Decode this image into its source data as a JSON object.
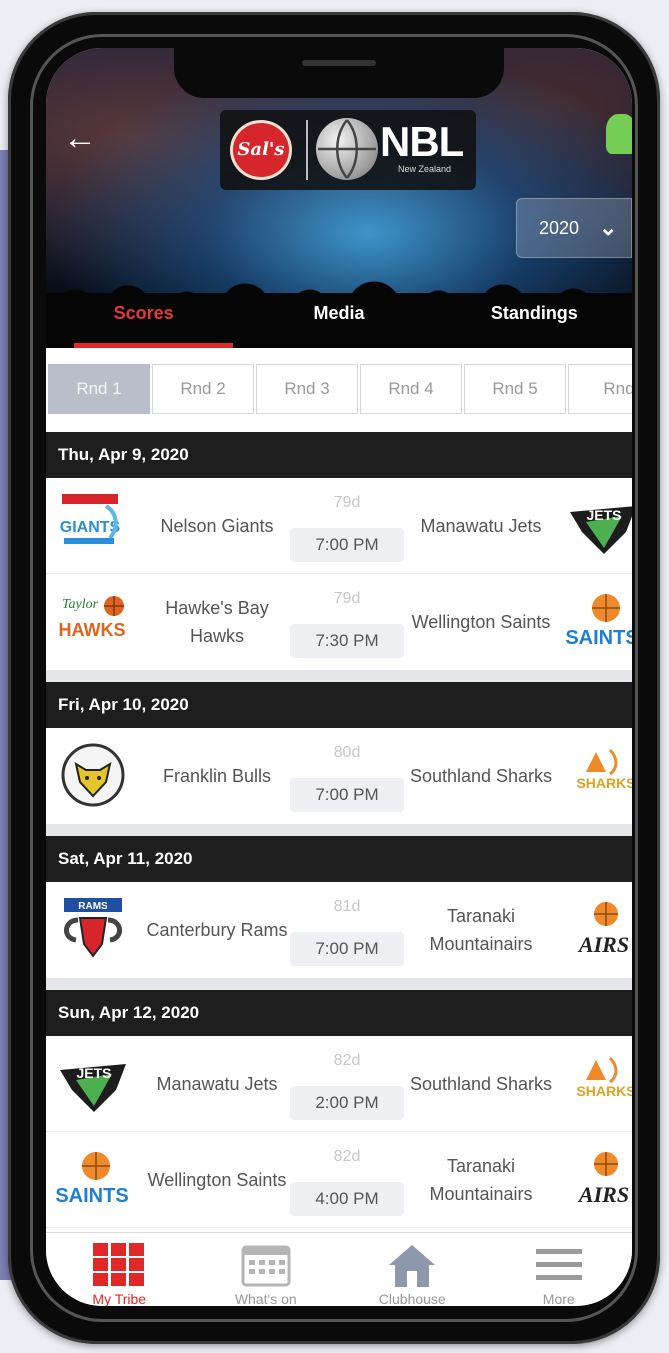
{
  "header": {
    "back_icon": "back-arrow-icon",
    "sponsor_logo_text": "Sal's",
    "league_logo_text": "NBL",
    "league_logo_subtext": "New Zealand",
    "season": "2020"
  },
  "tabs": [
    {
      "label": "Scores",
      "active": true
    },
    {
      "label": "Media",
      "active": false
    },
    {
      "label": "Standings",
      "active": false
    }
  ],
  "rounds": [
    {
      "label": "Rnd 1",
      "active": true
    },
    {
      "label": "Rnd 2",
      "active": false
    },
    {
      "label": "Rnd 3",
      "active": false
    },
    {
      "label": "Rnd 4",
      "active": false
    },
    {
      "label": "Rnd 5",
      "active": false
    },
    {
      "label": "Rnd",
      "active": false
    }
  ],
  "days": [
    {
      "date": "Thu, Apr 9, 2020",
      "games": [
        {
          "home": "Nelson Giants",
          "away": "Manawatu Jets",
          "tag": "79d",
          "time": "7:00 PM"
        },
        {
          "home": "Hawke's Bay Hawks",
          "away": "Wellington Saints",
          "tag": "79d",
          "time": "7:30 PM"
        }
      ]
    },
    {
      "date": "Fri, Apr 10, 2020",
      "games": [
        {
          "home": "Franklin Bulls",
          "away": "Southland Sharks",
          "tag": "80d",
          "time": "7:00 PM"
        }
      ]
    },
    {
      "date": "Sat, Apr 11, 2020",
      "games": [
        {
          "home": "Canterbury Rams",
          "away": "Taranaki Mountainairs",
          "tag": "81d",
          "time": "7:00 PM"
        }
      ]
    },
    {
      "date": "Sun, Apr 12, 2020",
      "games": [
        {
          "home": "Manawatu Jets",
          "away": "Southland Sharks",
          "tag": "82d",
          "time": "2:00 PM"
        },
        {
          "home": "Wellington Saints",
          "away": "Taranaki Mountainairs",
          "tag": "82d",
          "time": "4:00 PM"
        }
      ]
    }
  ],
  "bottom_nav": [
    {
      "label": "My Tribe",
      "icon": "grid-icon",
      "active": true
    },
    {
      "label": "What's on",
      "icon": "calendar-icon",
      "active": false
    },
    {
      "label": "Clubhouse",
      "icon": "home-icon",
      "active": false
    },
    {
      "label": "More",
      "icon": "menu-icon",
      "active": false
    }
  ],
  "colors": {
    "accent": "#e02828",
    "date_bar": "#1e1e1e",
    "round_active": "#b9bfca"
  }
}
